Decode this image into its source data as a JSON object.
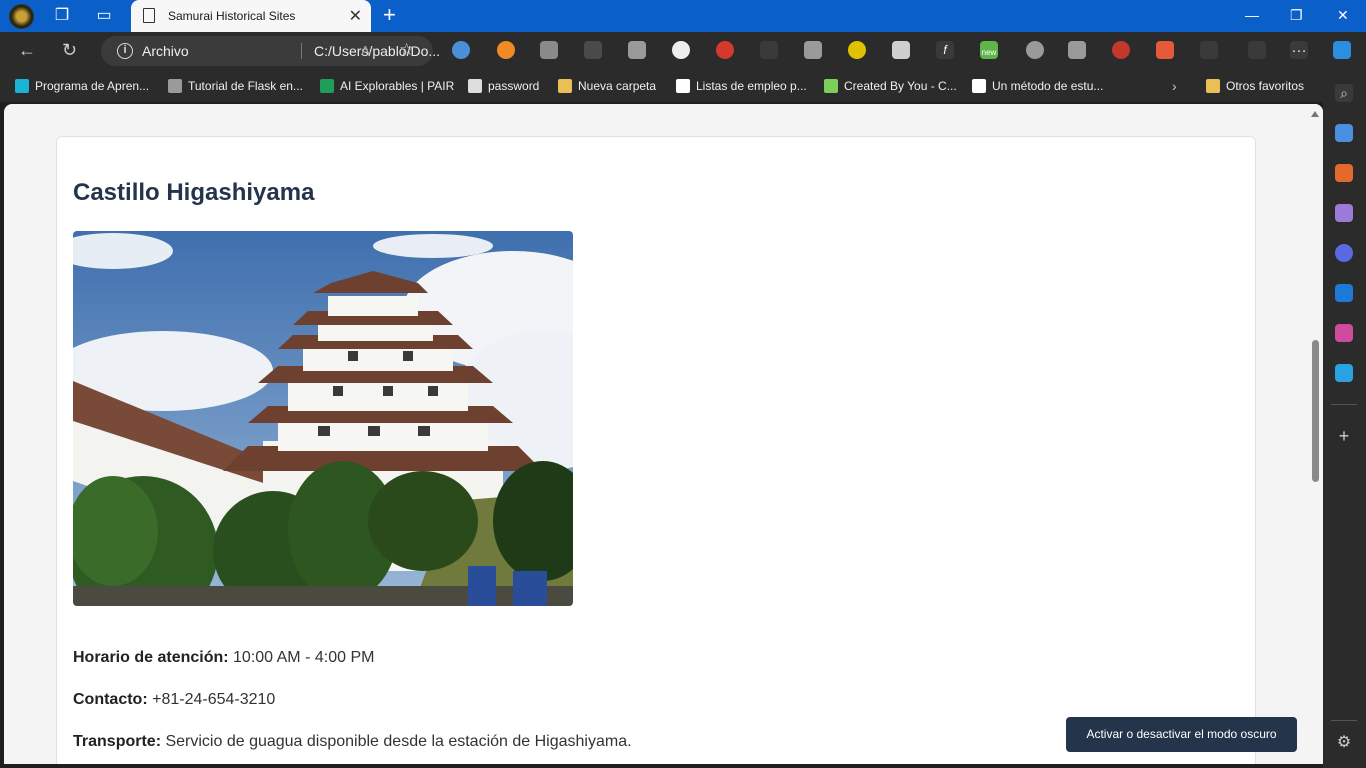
{
  "browser": {
    "tab_title": "Samurai Historical Sites",
    "address_label": "Archivo",
    "address_url": "C:/Users/pablo/Do...",
    "bookmarks": [
      {
        "label": "Programa de Apren...",
        "color": "#19b4d6"
      },
      {
        "label": "Tutorial de Flask en...",
        "color": "#9a9a9a"
      },
      {
        "label": "AI Explorables | PAIR",
        "color": "#1e9e5a"
      },
      {
        "label": "password",
        "color": "#dddddd"
      },
      {
        "label": "Nueva carpeta",
        "color": "#e8c055"
      },
      {
        "label": "Listas de empleo p...",
        "color": "#ffffff"
      },
      {
        "label": "Created By You - C...",
        "color": "#7ccf5a"
      },
      {
        "label": "Un método de estu...",
        "color": "#ffffff"
      }
    ],
    "other_bookmarks": "Otros favoritos",
    "extension_badge": "new"
  },
  "page": {
    "site_title": "Castillo Higashiyama",
    "photo_alt": "Castillo Higashiyama",
    "hours_label": "Horario de atención:",
    "hours_value": "10:00 AM - 4:00 PM",
    "contact_label": "Contacto:",
    "contact_value": "+81-24-654-3210",
    "transport_label": "Transporte:",
    "transport_value": "Servicio de guagua disponible desde la estación de Higashiyama.",
    "dark_mode_button": "Activar o desactivar el modo oscuro"
  },
  "colors": {
    "titlebar": "#0a5fc9",
    "heading": "#24344a",
    "button_bg": "#24344a"
  }
}
